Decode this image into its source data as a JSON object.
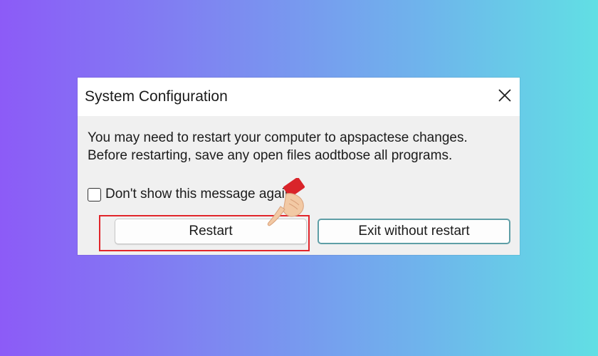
{
  "dialog": {
    "title": "System Configuration",
    "close_icon": "close-icon",
    "message_line1": "You may need to restart your computer to apspactese changes.",
    "message_line2": "Before restarting, save any open files aodtbose all programs.",
    "checkbox_label": "Don't show this message again",
    "checkbox_checked": false,
    "restart_label": "Restart",
    "exit_label": "Exit without restart"
  },
  "annotation": {
    "highlight_color": "#e1252b",
    "pointer_icon": "hand-pointer-icon"
  },
  "colors": {
    "background_left": "#8c5bf7",
    "background_right": "#61dfe4",
    "exit_button_border": "#5e9ea6"
  }
}
